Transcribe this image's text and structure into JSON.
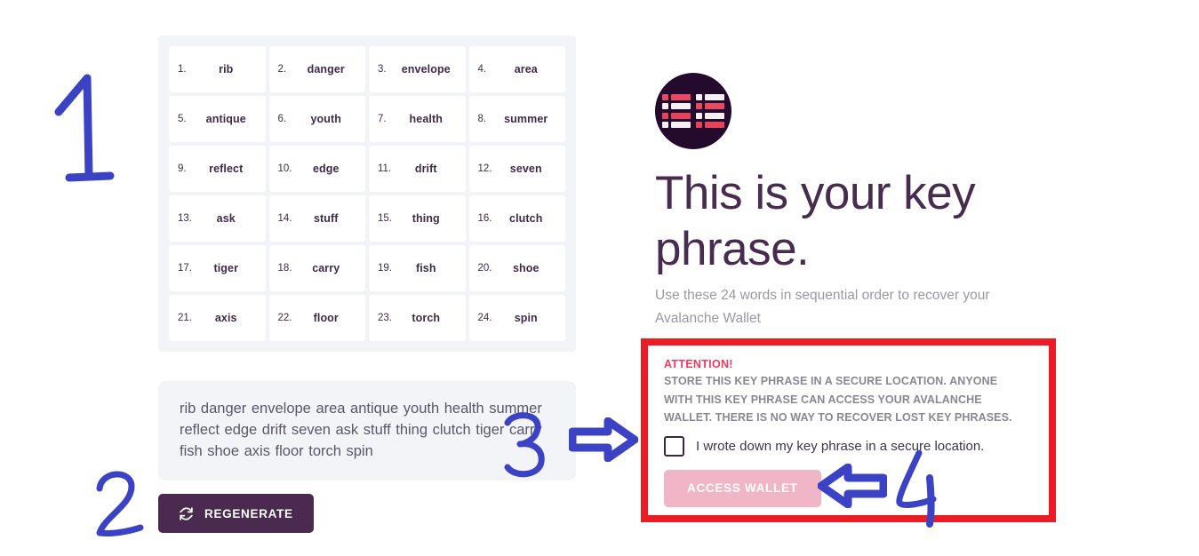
{
  "mnemonic": {
    "words": [
      {
        "index": "1.",
        "word": "rib"
      },
      {
        "index": "2.",
        "word": "danger"
      },
      {
        "index": "3.",
        "word": "envelope"
      },
      {
        "index": "4.",
        "word": "area"
      },
      {
        "index": "5.",
        "word": "antique"
      },
      {
        "index": "6.",
        "word": "youth"
      },
      {
        "index": "7.",
        "word": "health"
      },
      {
        "index": "8.",
        "word": "summer"
      },
      {
        "index": "9.",
        "word": "reflect"
      },
      {
        "index": "10.",
        "word": "edge"
      },
      {
        "index": "11.",
        "word": "drift"
      },
      {
        "index": "12.",
        "word": "seven"
      },
      {
        "index": "13.",
        "word": "ask"
      },
      {
        "index": "14.",
        "word": "stuff"
      },
      {
        "index": "15.",
        "word": "thing"
      },
      {
        "index": "16.",
        "word": "clutch"
      },
      {
        "index": "17.",
        "word": "tiger"
      },
      {
        "index": "18.",
        "word": "carry"
      },
      {
        "index": "19.",
        "word": "fish"
      },
      {
        "index": "20.",
        "word": "shoe"
      },
      {
        "index": "21.",
        "word": "axis"
      },
      {
        "index": "22.",
        "word": "floor"
      },
      {
        "index": "23.",
        "word": "torch"
      },
      {
        "index": "24.",
        "word": "spin"
      }
    ],
    "phrase_text": "rib danger envelope area antique youth health summer reflect edge drift seven ask stuff thing clutch tiger carry fish shoe axis floor torch spin"
  },
  "actions": {
    "regenerate_label": "REGENERATE",
    "regenerate_icon": "refresh-icon",
    "access_wallet_label": "ACCESS WALLET"
  },
  "hero": {
    "logo_icon": "avalanche-wallet-logo",
    "title": "This is your key phrase.",
    "subtitle": "Use these 24 words in sequential order to recover your Avalanche Wallet"
  },
  "attention": {
    "title": "ATTENTION!",
    "body": "STORE THIS KEY PHRASE IN A SECURE LOCATION. ANYONE WITH THIS KEY PHRASE CAN ACCESS YOUR AVALANCHE WALLET. THERE IS NO WAY TO RECOVER LOST KEY PHRASES.",
    "checkbox_label": "I wrote down my key phrase in a secure location.",
    "checkbox_checked": "false",
    "border_color": "#ec1c24",
    "title_color": "#ef3b5b"
  },
  "annotations": {
    "step_1": "1",
    "step_2": "2",
    "step_3": "3",
    "step_4": "4",
    "ink_color": "#3b42c4",
    "arrow_right": "arrow-right-icon",
    "arrow_left": "arrow-left-icon"
  },
  "colors": {
    "panel_bg": "#f2f4f8",
    "card_bg": "#ffffff",
    "primary_purple": "#4b2a50",
    "title_purple": "#472c4f",
    "disabled_pink": "#f0b5c6",
    "muted_text": "#9b98a4"
  }
}
